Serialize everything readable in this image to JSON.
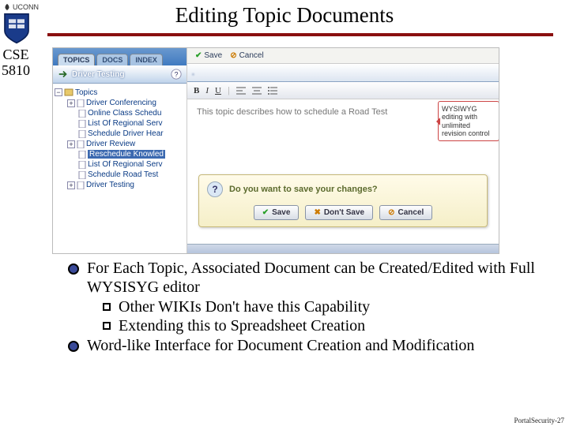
{
  "header": {
    "logo_inst": "UCONN",
    "title": "Editing Topic Documents",
    "course_line1": "CSE",
    "course_line2": "5810"
  },
  "app": {
    "tabs": {
      "topics": "TOPICS",
      "docs": "DOCS",
      "index": "INDEX"
    },
    "actions": {
      "save": "Save",
      "cancel": "Cancel"
    },
    "tree_title": "Driver Testing",
    "tree_root": "Topics",
    "tree": {
      "n1": "Driver Conferencing",
      "n2": "Online Class Schedu",
      "n3": "List Of Regional Serv",
      "n4": "Schedule Driver Hear",
      "n5": "Driver Review",
      "n6_selected": "Reschedule Knowled",
      "n7": "List Of Regional Serv",
      "n8": "Schedule Road Test",
      "n9": "Driver Testing"
    },
    "fmt": {
      "b": "B",
      "i": "I",
      "u": "U"
    },
    "doc_text": "This topic describes how to schedule a Road Test",
    "callout": "WYSIWYG editing with unlimited revision control",
    "dialog": {
      "msg": "Do you want to save your changes?",
      "save": "Save",
      "dont": "Don't Save",
      "cancel": "Cancel"
    }
  },
  "bullets": {
    "p1": "For Each Topic, Associated Document can be Created/Edited with Full WYSISYG editor",
    "p1a": "Other WIKIs Don't have this Capability",
    "p1b": "Extending this to Spreadsheet Creation",
    "p2": "Word-like Interface for Document Creation and Modification"
  },
  "footer": "PortalSecurity-27"
}
